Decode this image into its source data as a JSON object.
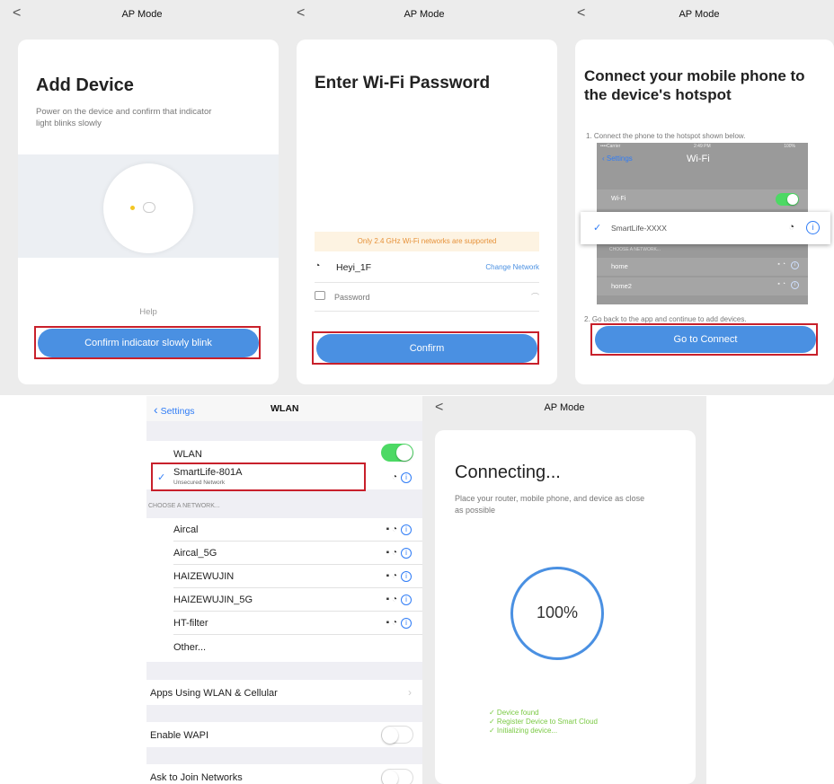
{
  "screen1": {
    "nav_title": "AP Mode",
    "back": "<",
    "title": "Add Device",
    "description": "Power on the device and confirm that indicator light blinks slowly",
    "help": "Help",
    "confirm_button": "Confirm indicator slowly blink"
  },
  "screen2": {
    "nav_title": "AP Mode",
    "back": "<",
    "title": "Enter Wi-Fi Password",
    "notice": "Only 2.4 GHz Wi-Fi networks are supported",
    "ssid": "Heyi_1F",
    "change_network": "Change Network",
    "password_placeholder": "Password",
    "confirm_button": "Confirm"
  },
  "screen3": {
    "nav_title": "AP Mode",
    "back": "<",
    "title": "Connect your mobile phone to the device's hotspot",
    "step1": "1. Connect the phone to the hotspot shown below.",
    "step2": "2. Go back to the app and continue to add devices.",
    "phone": {
      "status_carrier": "••••Carrier",
      "status_time": "2:49 PM",
      "status_battery": "100%",
      "back_label": "Settings",
      "title": "Wi-Fi",
      "wifi_label": "Wi-Fi",
      "selected_network": "SmartLife-XXXX",
      "choose_header": "CHOOSE A NETWORK...",
      "networks": [
        "home",
        "home2"
      ]
    },
    "connect_button": "Go to Connect"
  },
  "screen4": {
    "back_label": "Settings",
    "title": "WLAN",
    "wlan_label": "WLAN",
    "selected_network": "SmartLife-801A",
    "selected_sub": "Unsecured Network",
    "choose_header": "CHOOSE A NETWORK...",
    "networks": [
      "Aircal",
      "Aircal_5G",
      "HAIZEWUJIN",
      "HAIZEWUJIN_5G",
      "HT-filter"
    ],
    "other": "Other...",
    "apps_using": "Apps Using WLAN & Cellular",
    "enable_wapi": "Enable WAPI",
    "ask_to_join": "Ask to Join Networks"
  },
  "screen5": {
    "nav_title": "AP Mode",
    "back": "<",
    "title": "Connecting...",
    "description": "Place your router, mobile phone, and device as close as possible",
    "progress": "100%",
    "steps": [
      "✓ Device found",
      "✓ Register Device to Smart Cloud",
      "✓ Initializing device..."
    ]
  },
  "colors": {
    "accent": "#4a90e2",
    "highlight_box": "#c8202b",
    "toggle_on": "#4cd964",
    "success_text": "#7ac943",
    "ios_link": "#2f7cf6"
  }
}
